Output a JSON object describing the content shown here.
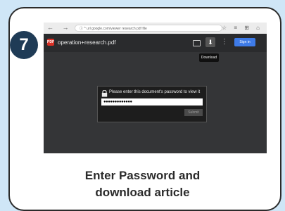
{
  "step": {
    "number": "7"
  },
  "browser": {
    "nav": "← → ↻",
    "address": "ⓘ ^ url google.com/viewer research pdf file",
    "right_icons": "☆ ≡ ⊞ ⌂"
  },
  "viewer": {
    "pdf_icon": "PDF",
    "filename": "operation+research.pdf",
    "download_glyph": "⬇",
    "more_glyph": "⋮",
    "signin_label": "Sign in",
    "tooltip": "Download"
  },
  "dialog": {
    "title": "Please enter this document's password to view it",
    "password_value": "●●●●●●●●●●●●●",
    "submit_label": "Submit"
  },
  "caption": {
    "line1": "Enter Password and",
    "line2": "download article"
  },
  "colors": {
    "background": "#cfe6f7",
    "badge": "#1f3b56",
    "signin": "#3e7be8",
    "pdf_icon": "#d93025"
  }
}
